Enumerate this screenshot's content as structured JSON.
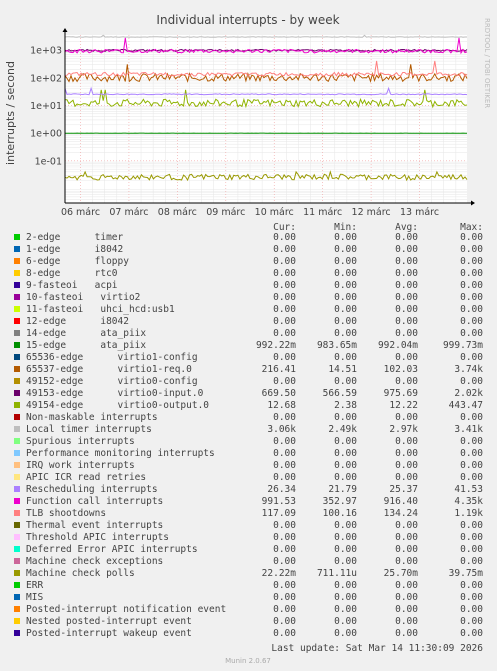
{
  "chart_data": {
    "type": "line",
    "title": "Individual interrupts - by week",
    "ylabel": "interrupts / second",
    "y_scale": "log",
    "ylim": [
      0.003,
      3500
    ],
    "y_ticks": [
      {
        "label": "1e+03",
        "value": 1000
      },
      {
        "label": "1e+02",
        "value": 100
      },
      {
        "label": "1e+01",
        "value": 10
      },
      {
        "label": "1e+00",
        "value": 1
      },
      {
        "label": "1e-01",
        "value": 0.1
      }
    ],
    "x_ticks": [
      "06 márc",
      "07 márc",
      "08 márc",
      "09 márc",
      "10 márc",
      "11 márc",
      "12 márc",
      "13 márc"
    ],
    "grid": true,
    "side_label": "RRDTOOL / TOBI OETIKER",
    "columns": [
      "Cur:",
      "Min:",
      "Avg:",
      "Max:"
    ],
    "series": [
      {
        "name": "2-edge      timer",
        "color": "#00cc00",
        "cur": "0.00",
        "min": "0.00",
        "avg": "0.00",
        "max": "0.00"
      },
      {
        "name": "1-edge      i8042",
        "color": "#0066b3",
        "cur": "0.00",
        "min": "0.00",
        "avg": "0.00",
        "max": "0.00"
      },
      {
        "name": "6-edge      floppy",
        "color": "#ff8000",
        "cur": "0.00",
        "min": "0.00",
        "avg": "0.00",
        "max": "0.00"
      },
      {
        "name": "8-edge      rtc0",
        "color": "#ffcc00",
        "cur": "0.00",
        "min": "0.00",
        "avg": "0.00",
        "max": "0.00"
      },
      {
        "name": "9-fasteoi   acpi",
        "color": "#330099",
        "cur": "0.00",
        "min": "0.00",
        "avg": "0.00",
        "max": "0.00"
      },
      {
        "name": "10-fasteoi   virtio2",
        "color": "#990099",
        "cur": "0.00",
        "min": "0.00",
        "avg": "0.00",
        "max": "0.00"
      },
      {
        "name": "11-fasteoi   uhci_hcd:usb1",
        "color": "#ccff00",
        "cur": "0.00",
        "min": "0.00",
        "avg": "0.00",
        "max": "0.00"
      },
      {
        "name": "12-edge      i8042",
        "color": "#ff0000",
        "cur": "0.00",
        "min": "0.00",
        "avg": "0.00",
        "max": "0.00"
      },
      {
        "name": "14-edge      ata_piix",
        "color": "#808080",
        "cur": "0.00",
        "min": "0.00",
        "avg": "0.00",
        "max": "0.00"
      },
      {
        "name": "15-edge      ata_piix",
        "color": "#008f00",
        "cur": "992.22m",
        "min": "983.65m",
        "avg": "992.04m",
        "max": "999.73m"
      },
      {
        "name": "65536-edge      virtio1-config",
        "color": "#00487d",
        "cur": "0.00",
        "min": "0.00",
        "avg": "0.00",
        "max": "0.00"
      },
      {
        "name": "65537-edge      virtio1-req.0",
        "color": "#b35a00",
        "cur": "216.41",
        "min": "14.51",
        "avg": "102.03",
        "max": "3.74k"
      },
      {
        "name": "49152-edge      virtio0-config",
        "color": "#b38f00",
        "cur": "0.00",
        "min": "0.00",
        "avg": "0.00",
        "max": "0.00"
      },
      {
        "name": "49153-edge      virtio0-input.0",
        "color": "#6b006b",
        "cur": "669.50",
        "min": "566.59",
        "avg": "975.69",
        "max": "2.02k"
      },
      {
        "name": "49154-edge      virtio0-output.0",
        "color": "#8fb300",
        "cur": "12.68",
        "min": "2.38",
        "avg": "12.22",
        "max": "443.47"
      },
      {
        "name": "Non-maskable interrupts",
        "color": "#b30000",
        "cur": "0.00",
        "min": "0.00",
        "avg": "0.00",
        "max": "0.00"
      },
      {
        "name": "Local timer interrupts",
        "color": "#bebebe",
        "cur": "3.06k",
        "min": "2.49k",
        "avg": "2.97k",
        "max": "3.41k"
      },
      {
        "name": "Spurious interrupts",
        "color": "#80ff80",
        "cur": "0.00",
        "min": "0.00",
        "avg": "0.00",
        "max": "0.00"
      },
      {
        "name": "Performance monitoring interrupts",
        "color": "#80c9ff",
        "cur": "0.00",
        "min": "0.00",
        "avg": "0.00",
        "max": "0.00"
      },
      {
        "name": "IRQ work interrupts",
        "color": "#ffc080",
        "cur": "0.00",
        "min": "0.00",
        "avg": "0.00",
        "max": "0.00"
      },
      {
        "name": "APIC ICR read retries",
        "color": "#ffe680",
        "cur": "0.00",
        "min": "0.00",
        "avg": "0.00",
        "max": "0.00"
      },
      {
        "name": "Rescheduling interrupts",
        "color": "#aa80ff",
        "cur": "26.34",
        "min": "21.79",
        "avg": "25.37",
        "max": "41.53"
      },
      {
        "name": "Function call interrupts",
        "color": "#ee00cc",
        "cur": "991.53",
        "min": "352.97",
        "avg": "916.40",
        "max": "4.35k"
      },
      {
        "name": "TLB shootdowns",
        "color": "#ff8080",
        "cur": "117.09",
        "min": "100.16",
        "avg": "134.24",
        "max": "1.19k"
      },
      {
        "name": "Thermal event interrupts",
        "color": "#666600",
        "cur": "0.00",
        "min": "0.00",
        "avg": "0.00",
        "max": "0.00"
      },
      {
        "name": "Threshold APIC interrupts",
        "color": "#ffbfff",
        "cur": "0.00",
        "min": "0.00",
        "avg": "0.00",
        "max": "0.00"
      },
      {
        "name": "Deferred Error APIC interrupts",
        "color": "#00ffcc",
        "cur": "0.00",
        "min": "0.00",
        "avg": "0.00",
        "max": "0.00"
      },
      {
        "name": "Machine check exceptions",
        "color": "#cc6699",
        "cur": "0.00",
        "min": "0.00",
        "avg": "0.00",
        "max": "0.00"
      },
      {
        "name": "Machine check polls",
        "color": "#999900",
        "cur": "22.22m",
        "min": "711.11u",
        "avg": "25.70m",
        "max": "39.75m"
      },
      {
        "name": "ERR",
        "color": "#00cc00",
        "cur": "0.00",
        "min": "0.00",
        "avg": "0.00",
        "max": "0.00"
      },
      {
        "name": "MIS",
        "color": "#0066b3",
        "cur": "0.00",
        "min": "0.00",
        "avg": "0.00",
        "max": "0.00"
      },
      {
        "name": "Posted-interrupt notification event",
        "color": "#ff8000",
        "cur": "0.00",
        "min": "0.00",
        "avg": "0.00",
        "max": "0.00"
      },
      {
        "name": "Nested posted-interrupt event",
        "color": "#ffcc00",
        "cur": "0.00",
        "min": "0.00",
        "avg": "0.00",
        "max": "0.00"
      },
      {
        "name": "Posted-interrupt wakeup event",
        "color": "#330099",
        "cur": "0.00",
        "min": "0.00",
        "avg": "0.00",
        "max": "0.00"
      }
    ],
    "last_update": "Last update: Sat Mar 14 11:30:09 2026",
    "footer": "Munin 2.0.67"
  }
}
